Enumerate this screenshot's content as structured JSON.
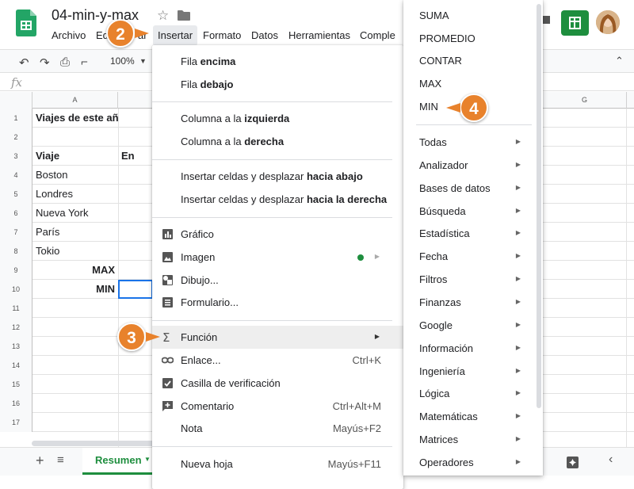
{
  "doc": {
    "title": "04-min-y-max"
  },
  "menubar": {
    "items": [
      "Archivo",
      "Ed",
      "ar",
      "Insertar",
      "Formato",
      "Datos",
      "Herramientas",
      "Comple"
    ]
  },
  "toolbar": {
    "zoom": "100%"
  },
  "formula": {
    "fx": "fx"
  },
  "columns": [
    "A",
    "G"
  ],
  "rows": [
    {
      "num": "1",
      "a": "Viajes de este año",
      "b": "",
      "bold": true
    },
    {
      "num": "2",
      "a": "",
      "b": ""
    },
    {
      "num": "3",
      "a": "Viaje",
      "b": "En",
      "bold": true
    },
    {
      "num": "4",
      "a": "Boston",
      "b": ""
    },
    {
      "num": "5",
      "a": "Londres",
      "b": ""
    },
    {
      "num": "6",
      "a": "Nueva York",
      "b": ""
    },
    {
      "num": "7",
      "a": "París",
      "b": ""
    },
    {
      "num": "8",
      "a": "Tokio",
      "b": ""
    },
    {
      "num": "9",
      "a": "MAX",
      "b": "",
      "bold": true,
      "right": true
    },
    {
      "num": "10",
      "a": "MIN",
      "b": "",
      "bold": true,
      "right": true
    },
    {
      "num": "11",
      "a": "",
      "b": ""
    },
    {
      "num": "12",
      "a": "",
      "b": ""
    },
    {
      "num": "13",
      "a": "",
      "b": ""
    },
    {
      "num": "14",
      "a": "",
      "b": ""
    },
    {
      "num": "15",
      "a": "",
      "b": ""
    },
    {
      "num": "16",
      "a": "",
      "b": ""
    },
    {
      "num": "17",
      "a": "",
      "b": ""
    }
  ],
  "sheet": {
    "tab": "Resumen"
  },
  "insert_menu": {
    "items": [
      {
        "pre": "Fila ",
        "bold": "encima",
        "shortcut": "",
        "icon": ""
      },
      {
        "pre": "Fila ",
        "bold": "debajo",
        "shortcut": "",
        "icon": ""
      },
      {
        "pre": "Columna a la ",
        "bold": "izquierda",
        "shortcut": "",
        "icon": ""
      },
      {
        "pre": "Columna a la ",
        "bold": "derecha",
        "shortcut": "",
        "icon": ""
      },
      {
        "pre": "Insertar celdas y desplazar ",
        "bold": "hacia abajo",
        "shortcut": "",
        "icon": ""
      },
      {
        "pre": "Insertar celdas y desplazar ",
        "bold": "hacia la derecha",
        "shortcut": "",
        "icon": ""
      },
      {
        "pre": "Gráfico",
        "bold": "",
        "shortcut": "",
        "icon": "chart-icon"
      },
      {
        "pre": "Imagen",
        "bold": "",
        "shortcut": "",
        "icon": "image-icon"
      },
      {
        "pre": "Dibujo...",
        "bold": "",
        "shortcut": "",
        "icon": "drawing-icon"
      },
      {
        "pre": "Formulario...",
        "bold": "",
        "shortcut": "",
        "icon": "form-icon"
      },
      {
        "pre": "Función",
        "bold": "",
        "shortcut": "",
        "icon": "sigma-icon"
      },
      {
        "pre": "Enlace...",
        "bold": "",
        "shortcut": "Ctrl+K",
        "icon": "link-icon"
      },
      {
        "pre": "Casilla de verificación",
        "bold": "",
        "shortcut": "",
        "icon": "checkbox-icon"
      },
      {
        "pre": "Comentario",
        "bold": "",
        "shortcut": "Ctrl+Alt+M",
        "icon": "comment-add-icon"
      },
      {
        "pre": "Nota",
        "bold": "",
        "shortcut": "Mayús+F2",
        "icon": ""
      },
      {
        "pre": "Nueva hoja",
        "bold": "",
        "shortcut": "Mayús+F11",
        "icon": ""
      }
    ]
  },
  "function_submenu": {
    "top": [
      "SUMA",
      "PROMEDIO",
      "CONTAR",
      "MAX",
      "MIN"
    ],
    "categories": [
      "Todas",
      "Analizador",
      "Bases de datos",
      "Búsqueda",
      "Estadística",
      "Fecha",
      "Filtros",
      "Finanzas",
      "Google",
      "Información",
      "Ingeniería",
      "Lógica",
      "Matemáticas",
      "Matrices",
      "Operadores"
    ]
  },
  "callouts": [
    "2",
    "3",
    "4"
  ],
  "colors": {
    "accent": "#e8822c",
    "sheets_green": "#1e8e3e",
    "selection": "#1a73e8"
  }
}
